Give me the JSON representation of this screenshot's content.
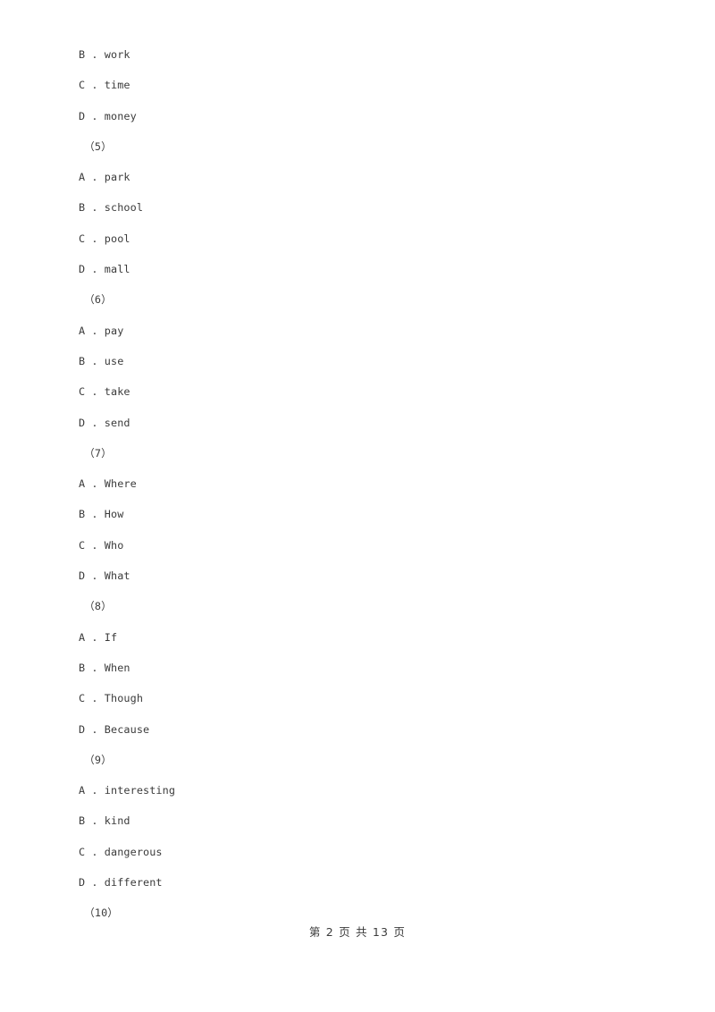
{
  "document": {
    "page_background": "#ffffff",
    "text_color": "#3b3b3b"
  },
  "lines": [
    {
      "kind": "option",
      "text": "B . work"
    },
    {
      "kind": "option",
      "text": "C . time"
    },
    {
      "kind": "option",
      "text": "D . money"
    },
    {
      "kind": "qnum",
      "text": "（5）"
    },
    {
      "kind": "option",
      "text": "A . park"
    },
    {
      "kind": "option",
      "text": "B . school"
    },
    {
      "kind": "option",
      "text": "C . pool"
    },
    {
      "kind": "option",
      "text": "D . mall"
    },
    {
      "kind": "qnum",
      "text": "（6）"
    },
    {
      "kind": "option",
      "text": "A . pay"
    },
    {
      "kind": "option",
      "text": "B . use"
    },
    {
      "kind": "option",
      "text": "C . take"
    },
    {
      "kind": "option",
      "text": "D . send"
    },
    {
      "kind": "qnum",
      "text": "（7）"
    },
    {
      "kind": "option",
      "text": "A . Where"
    },
    {
      "kind": "option",
      "text": "B . How"
    },
    {
      "kind": "option",
      "text": "C . Who"
    },
    {
      "kind": "option",
      "text": "D . What"
    },
    {
      "kind": "qnum",
      "text": "（8）"
    },
    {
      "kind": "option",
      "text": "A . If"
    },
    {
      "kind": "option",
      "text": "B . When"
    },
    {
      "kind": "option",
      "text": "C . Though"
    },
    {
      "kind": "option",
      "text": "D . Because"
    },
    {
      "kind": "qnum",
      "text": "（9）"
    },
    {
      "kind": "option",
      "text": "A . interesting"
    },
    {
      "kind": "option",
      "text": "B . kind"
    },
    {
      "kind": "option",
      "text": "C . dangerous"
    },
    {
      "kind": "option",
      "text": "D . different"
    },
    {
      "kind": "qnum",
      "text": "（10）"
    }
  ],
  "footer": {
    "text": "第 2 页 共 13 页",
    "current_page": "2",
    "total_pages": "13"
  }
}
